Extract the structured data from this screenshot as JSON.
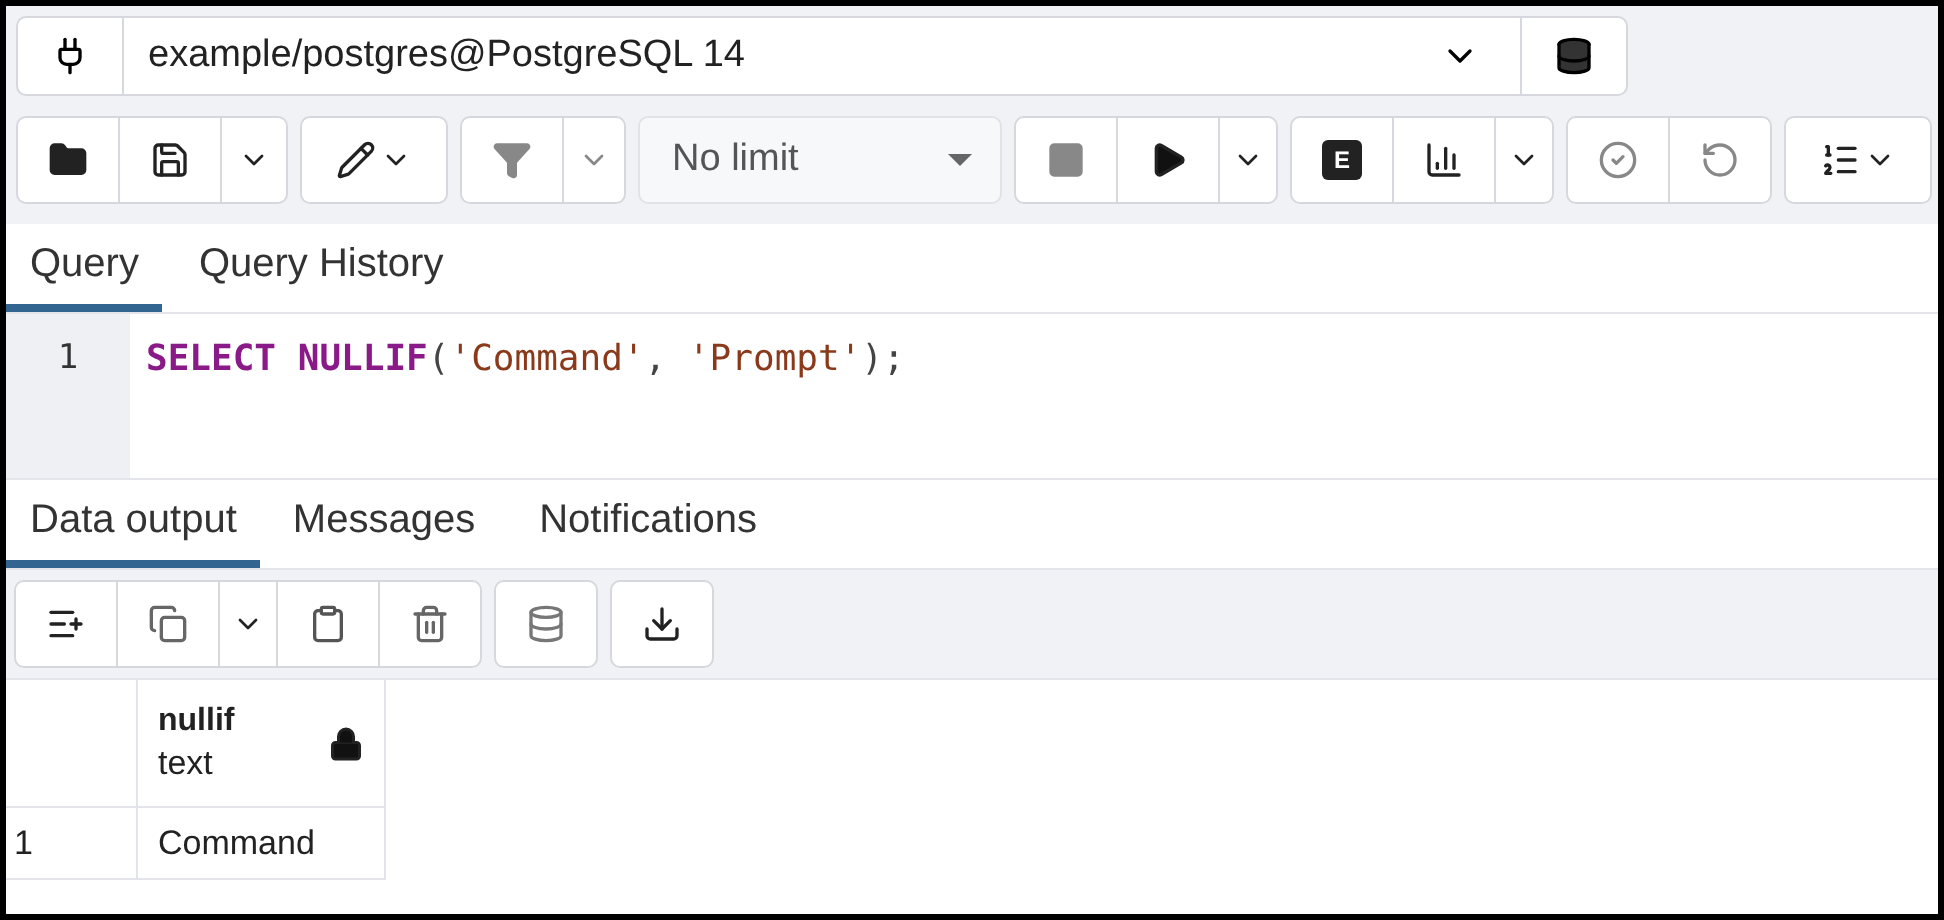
{
  "connection": {
    "value": "example/postgres@PostgreSQL 14"
  },
  "toolbar": {
    "limit": "No limit",
    "explain_label": "E"
  },
  "editor_tabs": [
    {
      "label": "Query",
      "selected": true
    },
    {
      "label": "Query History",
      "selected": false
    }
  ],
  "editor": {
    "lines": [
      {
        "number": "1",
        "tokens": [
          {
            "kind": "keyword",
            "text": "SELECT NULLIF"
          },
          {
            "kind": "punct",
            "text": "("
          },
          {
            "kind": "string",
            "text": "'Command'"
          },
          {
            "kind": "punct",
            "text": ", "
          },
          {
            "kind": "string",
            "text": "'Prompt'"
          },
          {
            "kind": "punct",
            "text": ");"
          }
        ]
      }
    ]
  },
  "output_tabs": [
    {
      "label": "Data output",
      "selected": true
    },
    {
      "label": "Messages",
      "selected": false
    },
    {
      "label": "Notifications",
      "selected": false
    }
  ],
  "table": {
    "columns": [
      {
        "name": "nullif",
        "type": "text",
        "locked": true
      }
    ],
    "rows": [
      {
        "number": "1",
        "cells": [
          "Command"
        ]
      }
    ]
  }
}
